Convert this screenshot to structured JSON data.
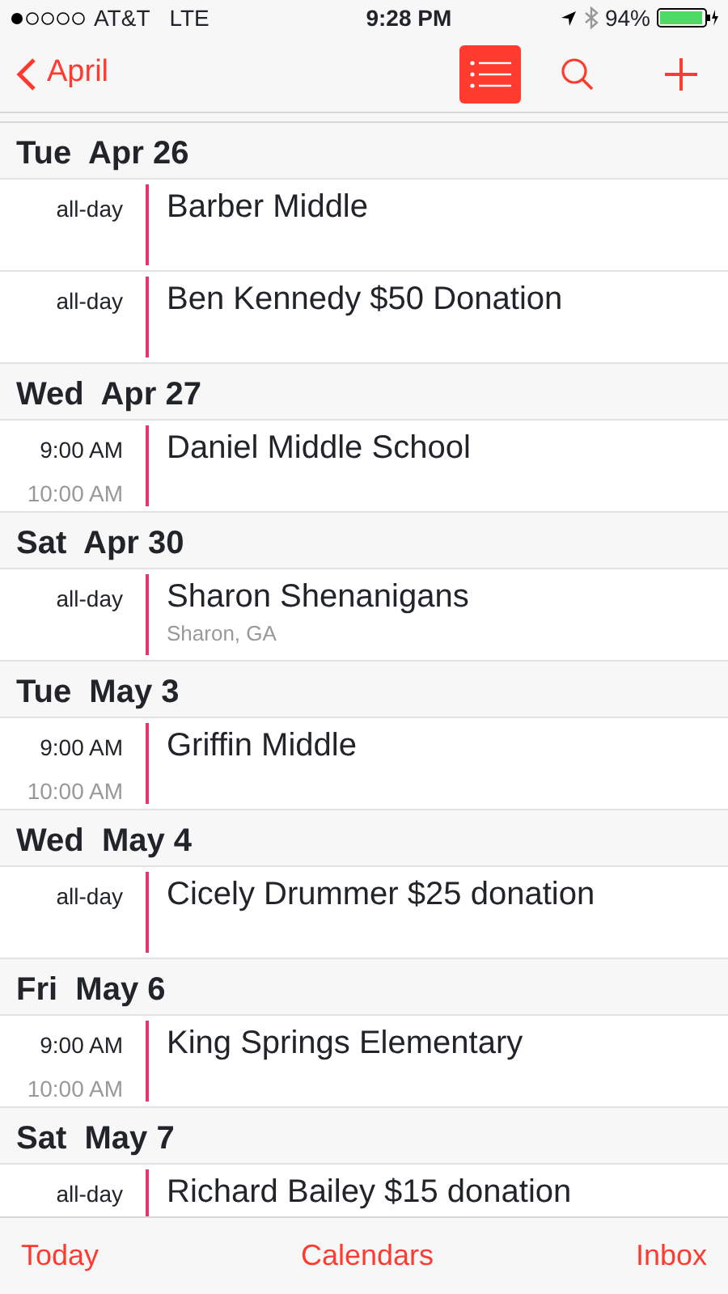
{
  "status_bar": {
    "carrier": "AT&T",
    "network": "LTE",
    "time": "9:28 PM",
    "battery": "94%"
  },
  "nav": {
    "back": "April",
    "tools": [
      {
        "kind": "list",
        "selected": true
      },
      {
        "kind": "search",
        "selected": false
      },
      {
        "kind": "add",
        "selected": false
      }
    ]
  },
  "days": [
    {
      "date": "Tue  Apr 26",
      "events": [
        {
          "kind": "all-day",
          "time": "all-day",
          "title": "Barber Middle"
        },
        {
          "kind": "all-day",
          "time": "all-day",
          "title": "Ben Kennedy $50 Donation"
        }
      ]
    },
    {
      "date": "Wed  Apr 27",
      "events": [
        {
          "kind": "timed",
          "time": "9:00 AM",
          "end": "10:00 AM",
          "title": "Daniel Middle School"
        }
      ]
    },
    {
      "date": "Sat  Apr 30",
      "events": [
        {
          "kind": "all-day",
          "time": "all-day",
          "title": "Sharon Shenanigans",
          "location": "Sharon, GA"
        }
      ]
    },
    {
      "date": "Tue  May 3",
      "events": [
        {
          "kind": "timed",
          "time": "9:00 AM",
          "end": "10:00 AM",
          "title": "Griffin Middle"
        }
      ]
    },
    {
      "date": "Wed  May 4",
      "events": [
        {
          "kind": "all-day",
          "time": "all-day",
          "title": "Cicely Drummer $25 donation"
        }
      ]
    },
    {
      "date": "Fri  May 6",
      "events": [
        {
          "kind": "timed",
          "time": "9:00 AM",
          "end": "10:00 AM",
          "title": "King Springs Elementary"
        }
      ]
    },
    {
      "date": "Sat  May 7",
      "events": [
        {
          "kind": "all-day",
          "time": "all-day",
          "title": "Richard Bailey $15 donation"
        }
      ]
    }
  ],
  "tab_bar": [
    "Today",
    "Calendars",
    "Inbox"
  ]
}
